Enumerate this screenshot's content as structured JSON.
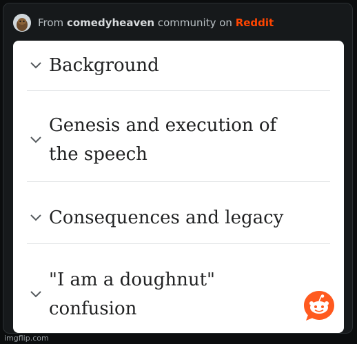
{
  "header": {
    "prefix": "From",
    "community": "comedyheaven",
    "middle": "community on",
    "brand": "Reddit"
  },
  "toc": {
    "items": [
      {
        "line1": "Background",
        "line2": ""
      },
      {
        "line1": "Genesis and execution of",
        "line2": "the speech"
      },
      {
        "line1": "Consequences and legacy",
        "line2": ""
      },
      {
        "line1": "\"I am a doughnut\"",
        "line2": "confusion"
      }
    ]
  },
  "colors": {
    "accent": "#ff4500",
    "card_bg": "#ffffff",
    "embed_bg": "#16191b"
  },
  "icons": {
    "chevron": "chevron-down-icon",
    "fab": "reddit-chat-icon",
    "avatar": "community-avatar"
  },
  "watermark": "imgflip.com"
}
